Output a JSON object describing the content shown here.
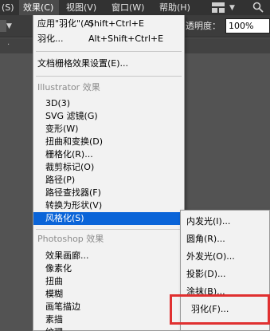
{
  "menubar": {
    "items": [
      {
        "label": "(S)"
      },
      {
        "label": "效果(C)",
        "active": true
      },
      {
        "label": "视图(V)"
      },
      {
        "label": "窗口(W)"
      },
      {
        "label": "帮助(H)"
      }
    ],
    "icons": [
      "workspace-switcher-icon",
      "chevron-down-icon",
      "search-icon"
    ]
  },
  "controlbar": {
    "opacity_label": "透明度：",
    "opacity_value": "100%"
  },
  "effect_menu": {
    "apply_last": {
      "label": "应用\"羽化\"(A)",
      "shortcut": "Shift+Ctrl+E"
    },
    "last_effect": {
      "label": "羽化...",
      "shortcut": "Alt+Shift+Ctrl+E"
    },
    "raster_settings": "文档栅格效果设置(E)...",
    "illustrator_header": "Illustrator 效果",
    "illustrator_items": [
      "3D(3)",
      "SVG 滤镜(G)",
      "变形(W)",
      "扭曲和变换(D)",
      "栅格化(R)...",
      "裁剪标记(O)",
      "路径(P)",
      "路径查找器(F)",
      "转换为形状(V)",
      "风格化(S)"
    ],
    "highlighted_item": "风格化(S)",
    "photoshop_header": "Photoshop 效果",
    "photoshop_items": [
      "效果画廊...",
      "像素化",
      "扭曲",
      "模糊",
      "画笔描边",
      "素描",
      "纹理"
    ]
  },
  "stylize_submenu": {
    "items": [
      "内发光(I)...",
      "圆角(R)...",
      "外发光(O)...",
      "投影(D)...",
      "涂抹(B)...",
      "羽化(F)..."
    ],
    "annotated_item": "羽化(F)...",
    "annotation_color": "#e03030"
  },
  "colors": {
    "highlight": "#0a64d8",
    "menu_bg": "#f2f2f2",
    "app_bg": "#535353"
  }
}
